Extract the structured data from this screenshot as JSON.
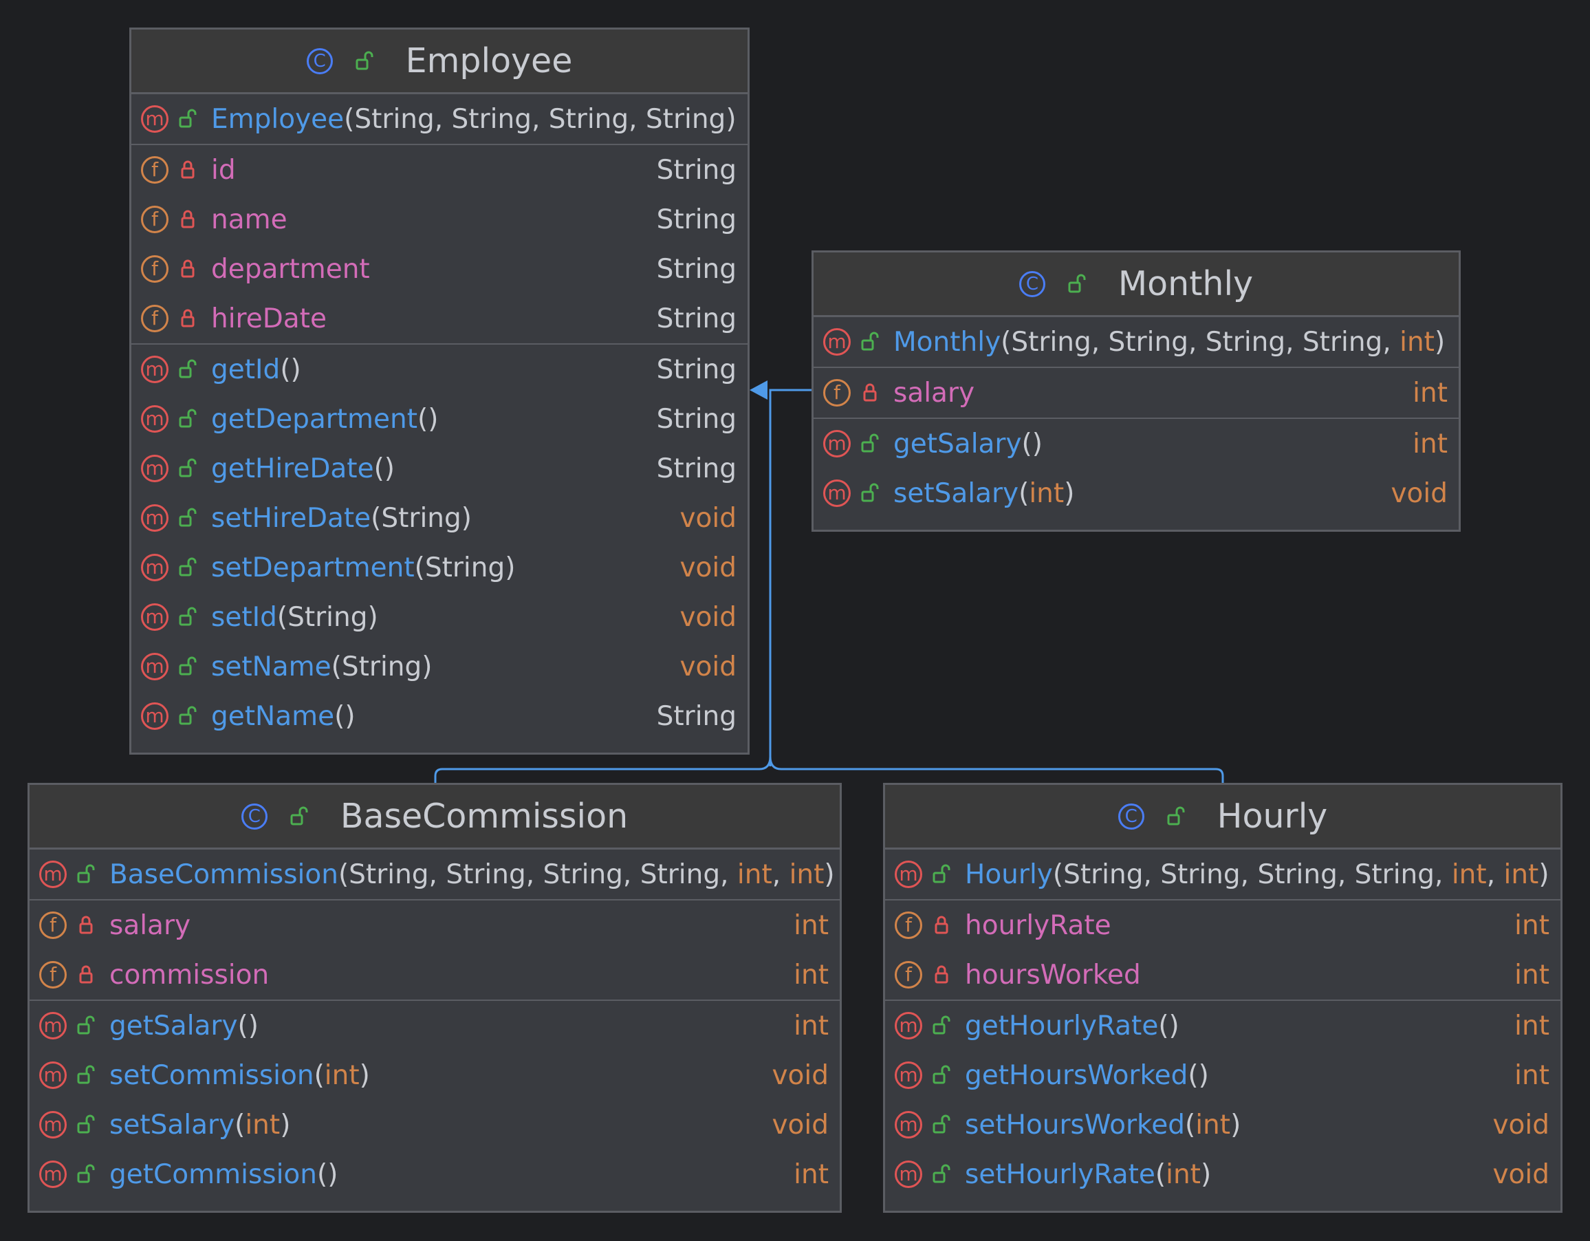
{
  "colors": {
    "background": "#1e1f22",
    "box": "#393b40",
    "header": "#3a3a3a",
    "border": "#5b5d63",
    "method_name": "#4f9ae8",
    "field_name": "#d36cb8",
    "keyword": "#d2844a",
    "method_badge": "#e05555",
    "field_badge": "#d2844a",
    "class_badge": "#4a7df5",
    "public_lock": "#4caf50",
    "private_lock": "#e05555",
    "inheritance_line": "#4f9ae8"
  },
  "classes": {
    "employee": {
      "name": "Employee",
      "constructor": {
        "name": "Employee",
        "params": [
          {
            "t": "(String, String, String, String)",
            "k": false
          }
        ]
      },
      "fields": [
        {
          "name": "id",
          "type": "String"
        },
        {
          "name": "name",
          "type": "String"
        },
        {
          "name": "department",
          "type": "String"
        },
        {
          "name": "hireDate",
          "type": "String"
        }
      ],
      "methods": [
        {
          "name": "getId",
          "params": [
            {
              "t": "()",
              "k": false
            }
          ],
          "type": "String"
        },
        {
          "name": "getDepartment",
          "params": [
            {
              "t": "()",
              "k": false
            }
          ],
          "type": "String"
        },
        {
          "name": "getHireDate",
          "params": [
            {
              "t": "()",
              "k": false
            }
          ],
          "type": "String"
        },
        {
          "name": "setHireDate",
          "params": [
            {
              "t": "(String)",
              "k": false
            }
          ],
          "type": "void"
        },
        {
          "name": "setDepartment",
          "params": [
            {
              "t": "(String)",
              "k": false
            }
          ],
          "type": "void"
        },
        {
          "name": "setId",
          "params": [
            {
              "t": "(String)",
              "k": false
            }
          ],
          "type": "void"
        },
        {
          "name": "setName",
          "params": [
            {
              "t": "(String)",
              "k": false
            }
          ],
          "type": "void"
        },
        {
          "name": "getName",
          "params": [
            {
              "t": "()",
              "k": false
            }
          ],
          "type": "String"
        }
      ]
    },
    "monthly": {
      "name": "Monthly",
      "constructor": {
        "name": "Monthly",
        "params": [
          {
            "t": "(String, String, String, String, ",
            "k": false
          },
          {
            "t": "int",
            "k": true
          },
          {
            "t": ")",
            "k": false
          }
        ]
      },
      "fields": [
        {
          "name": "salary",
          "type": "int"
        }
      ],
      "methods": [
        {
          "name": "getSalary",
          "params": [
            {
              "t": "()",
              "k": false
            }
          ],
          "type": "int"
        },
        {
          "name": "setSalary",
          "params": [
            {
              "t": "(",
              "k": false
            },
            {
              "t": "int",
              "k": true
            },
            {
              "t": ")",
              "k": false
            }
          ],
          "type": "void"
        }
      ]
    },
    "basecommission": {
      "name": "BaseCommission",
      "constructor": {
        "name": "BaseCommission",
        "params": [
          {
            "t": "(String, String, String, String, ",
            "k": false
          },
          {
            "t": "int",
            "k": true
          },
          {
            "t": ", ",
            "k": false
          },
          {
            "t": "int",
            "k": true
          },
          {
            "t": ")",
            "k": false
          }
        ]
      },
      "fields": [
        {
          "name": "salary",
          "type": "int"
        },
        {
          "name": "commission",
          "type": "int"
        }
      ],
      "methods": [
        {
          "name": "getSalary",
          "params": [
            {
              "t": "()",
              "k": false
            }
          ],
          "type": "int"
        },
        {
          "name": "setCommission",
          "params": [
            {
              "t": "(",
              "k": false
            },
            {
              "t": "int",
              "k": true
            },
            {
              "t": ")",
              "k": false
            }
          ],
          "type": "void"
        },
        {
          "name": "setSalary",
          "params": [
            {
              "t": "(",
              "k": false
            },
            {
              "t": "int",
              "k": true
            },
            {
              "t": ")",
              "k": false
            }
          ],
          "type": "void"
        },
        {
          "name": "getCommission",
          "params": [
            {
              "t": "()",
              "k": false
            }
          ],
          "type": "int"
        }
      ]
    },
    "hourly": {
      "name": "Hourly",
      "constructor": {
        "name": "Hourly",
        "params": [
          {
            "t": "(String, String, String, String, ",
            "k": false
          },
          {
            "t": "int",
            "k": true
          },
          {
            "t": ", ",
            "k": false
          },
          {
            "t": "int",
            "k": true
          },
          {
            "t": ")",
            "k": false
          }
        ]
      },
      "fields": [
        {
          "name": "hourlyRate",
          "type": "int"
        },
        {
          "name": "hoursWorked",
          "type": "int"
        }
      ],
      "methods": [
        {
          "name": "getHourlyRate",
          "params": [
            {
              "t": "()",
              "k": false
            }
          ],
          "type": "int"
        },
        {
          "name": "getHoursWorked",
          "params": [
            {
              "t": "()",
              "k": false
            }
          ],
          "type": "int"
        },
        {
          "name": "setHoursWorked",
          "params": [
            {
              "t": "(",
              "k": false
            },
            {
              "t": "int",
              "k": true
            },
            {
              "t": ")",
              "k": false
            }
          ],
          "type": "void"
        },
        {
          "name": "setHourlyRate",
          "params": [
            {
              "t": "(",
              "k": false
            },
            {
              "t": "int",
              "k": true
            },
            {
              "t": ")",
              "k": false
            }
          ],
          "type": "void"
        }
      ]
    }
  },
  "relations": [
    {
      "from": "Monthly",
      "to": "Employee",
      "kind": "extends"
    },
    {
      "from": "BaseCommission",
      "to": "Employee",
      "kind": "extends"
    },
    {
      "from": "Hourly",
      "to": "Employee",
      "kind": "extends"
    }
  ]
}
